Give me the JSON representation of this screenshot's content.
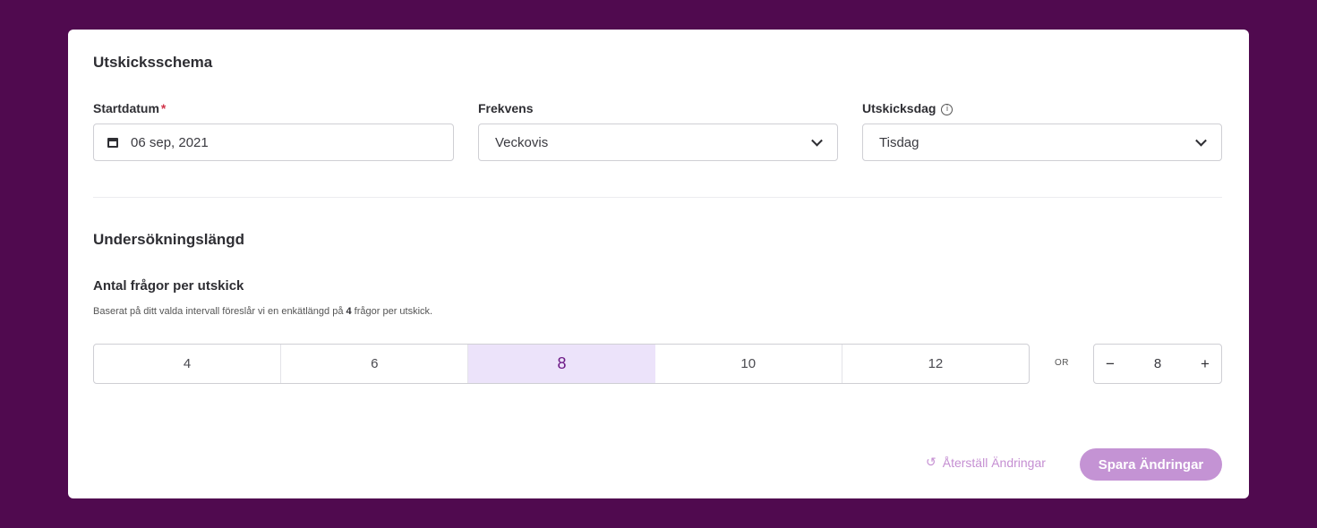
{
  "schedule": {
    "title": "Utskicksschema",
    "start_date": {
      "label": "Startdatum",
      "required_mark": "*",
      "value": "06 sep, 2021",
      "icon": "calendar-icon"
    },
    "frequency": {
      "label": "Frekvens",
      "value": "Veckovis",
      "icon": "chevron-down-icon"
    },
    "send_day": {
      "label": "Utskicksdag",
      "info_glyph": "i",
      "value": "Tisdag",
      "icon": "chevron-down-icon"
    }
  },
  "survey_length": {
    "title": "Undersökningslängd",
    "questions_label": "Antal frågor per utskick",
    "hint_prefix": "Baserat på ditt valda intervall föreslår vi en enkätlängd på ",
    "hint_number": "4",
    "hint_suffix": " frågor per utskick.",
    "options": [
      "4",
      "6",
      "8",
      "10",
      "12"
    ],
    "selected": "8",
    "or_text": "OR",
    "stepper": {
      "minus": "−",
      "value": "8",
      "plus": "+"
    }
  },
  "actions": {
    "reset_icon": "↺",
    "reset_label": "Återställ Ändringar",
    "save_label": "Spara Ändringar"
  },
  "colors": {
    "background": "#500a4f",
    "selected_bg": "#ece3fa",
    "selected_text": "#6d1a86",
    "save_button": "#c493d4",
    "required": "#d1344a"
  }
}
